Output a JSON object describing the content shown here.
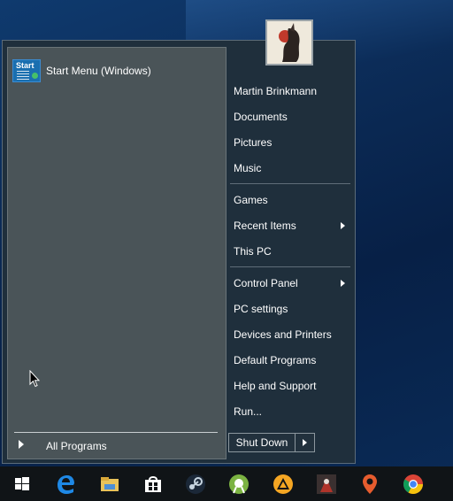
{
  "start_menu": {
    "pinned": [
      {
        "label": "Start Menu (Windows)",
        "icon": "start-menu-app-icon",
        "icon_text": "Start"
      }
    ],
    "all_programs_label": "All Programs",
    "user_avatar": "user-avatar-icon",
    "right_items": [
      {
        "label": "Martin Brinkmann",
        "submenu": false
      },
      {
        "label": "Documents",
        "submenu": false
      },
      {
        "label": "Pictures",
        "submenu": false
      },
      {
        "label": "Music",
        "submenu": false
      },
      {
        "label": "Games",
        "submenu": false
      },
      {
        "label": "Recent Items",
        "submenu": true
      },
      {
        "label": "This PC",
        "submenu": false
      },
      {
        "label": "Control Panel",
        "submenu": true
      },
      {
        "label": "PC settings",
        "submenu": false
      },
      {
        "label": "Devices and Printers",
        "submenu": false
      },
      {
        "label": "Default Programs",
        "submenu": false
      },
      {
        "label": "Help and Support",
        "submenu": false
      },
      {
        "label": "Run...",
        "submenu": false
      }
    ],
    "shutdown_label": "Shut Down"
  },
  "taskbar": {
    "icons": [
      "windows-start-icon",
      "edge-icon",
      "file-explorer-icon",
      "store-icon",
      "steam-icon",
      "android-studio-icon",
      "vlc-icon",
      "game-icon",
      "maps-icon",
      "chrome-icon"
    ]
  },
  "colors": {
    "menu_bg": "#1f2f3c",
    "left_pane_bg": "#4a5458",
    "taskbar_bg": "#101417",
    "desktop_blue": "#0b2a55"
  }
}
